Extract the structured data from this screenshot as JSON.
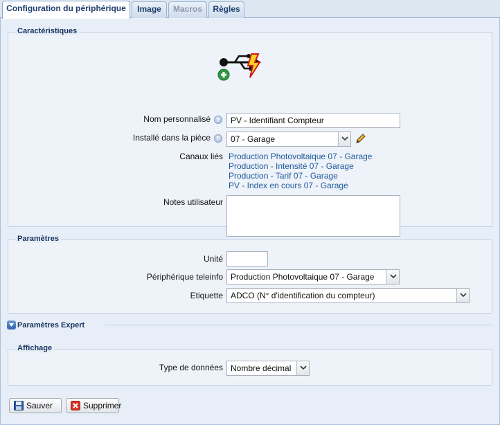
{
  "tabs": [
    {
      "label": "Configuration du périphérique",
      "state": "active"
    },
    {
      "label": "Image",
      "state": "normal"
    },
    {
      "label": "Macros",
      "state": "disabled"
    },
    {
      "label": "Règles",
      "state": "normal"
    }
  ],
  "caracteristiques": {
    "legend": "Caractéristiques",
    "device_icon": "usb-plus-lightning-icon",
    "nom_label": "Nom personnalisé",
    "nom_value": "PV - Identifiant Compteur",
    "piece_label": "Installé dans la pièce",
    "piece_value": "07 - Garage",
    "canaux_label": "Canaux liés",
    "canaux": [
      "Production Photovoltaique 07 - Garage",
      "Production - Intensité 07 - Garage",
      "Production - Tarif 07 - Garage",
      "PV - Index en cours 07 - Garage"
    ],
    "notes_label": "Notes utilisateur",
    "notes_value": ""
  },
  "parametres": {
    "legend": "Paramètres",
    "unite_label": "Unité",
    "unite_value": "",
    "teleinfo_label": "Périphérique teleinfo",
    "teleinfo_value": "Production Photovoltaique 07 - Garage",
    "etiquette_label": "Etiquette",
    "etiquette_value": "ADCO (N° d'identification du compteur)"
  },
  "expert": {
    "label": "Paramètres Expert"
  },
  "affichage": {
    "legend": "Affichage",
    "type_label": "Type de données",
    "type_value": "Nombre décimal"
  },
  "buttons": {
    "save_label": "Sauver",
    "delete_label": "Supprimer"
  },
  "colors": {
    "link": "#1e5a9b",
    "panel": "#e8eef7",
    "accent": "#17345f"
  }
}
